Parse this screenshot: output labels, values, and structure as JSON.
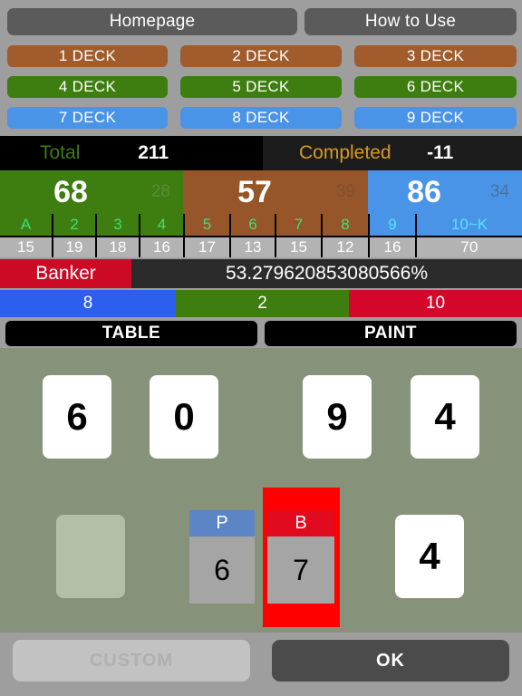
{
  "topnav": {
    "homepage_label": "Homepage",
    "how_to_use_label": "How to Use"
  },
  "decks": [
    {
      "label": "1 DECK",
      "color": "#a05c2c"
    },
    {
      "label": "2 DECK",
      "color": "#a05c2c"
    },
    {
      "label": "3 DECK",
      "color": "#a05c2c"
    },
    {
      "label": "4 DECK",
      "color": "#3e7d10"
    },
    {
      "label": "5 DECK",
      "color": "#3e7d10"
    },
    {
      "label": "6 DECK",
      "color": "#3e7d10"
    },
    {
      "label": "7 DECK",
      "color": "#4a94e8"
    },
    {
      "label": "8 DECK",
      "color": "#4a94e8"
    },
    {
      "label": "9 DECK",
      "color": "#4a94e8"
    }
  ],
  "summary": {
    "total_label": "Total",
    "total_value": "211",
    "completed_label": "Completed",
    "completed_value": "-11"
  },
  "groups": [
    {
      "main": "68",
      "sub": "28",
      "color": "#3e7d10"
    },
    {
      "main": "57",
      "sub": "39",
      "color": "#96562a"
    },
    {
      "main": "86",
      "sub": "34",
      "color": "#4a94e8"
    }
  ],
  "ranks": [
    {
      "rank": "A",
      "count": "15",
      "group": "green"
    },
    {
      "rank": "2",
      "count": "19",
      "group": "green"
    },
    {
      "rank": "3",
      "count": "18",
      "group": "green"
    },
    {
      "rank": "4",
      "count": "16",
      "group": "green"
    },
    {
      "rank": "5",
      "count": "17",
      "group": "brown"
    },
    {
      "rank": "6",
      "count": "13",
      "group": "brown"
    },
    {
      "rank": "7",
      "count": "15",
      "group": "brown"
    },
    {
      "rank": "8",
      "count": "12",
      "group": "brown"
    },
    {
      "rank": "9",
      "count": "16",
      "group": "blue"
    },
    {
      "rank": "10~K",
      "count": "70",
      "group": "blue"
    }
  ],
  "banker": {
    "label": "Banker",
    "percent": "53.279620853080566%",
    "tag_color": "#cc0a26"
  },
  "outcomes": [
    {
      "value": "8",
      "color": "#2c5ef0"
    },
    {
      "value": "2",
      "color": "#3e7d10"
    },
    {
      "value": "10",
      "color": "#d4072b"
    }
  ],
  "modebar": {
    "table_label": "TABLE",
    "paint_label": "PAINT"
  },
  "felt": {
    "background_color": "#869279",
    "row1_cards": [
      {
        "value": "6",
        "empty": false
      },
      {
        "value": "0",
        "empty": false
      },
      {
        "value": "9",
        "empty": false
      },
      {
        "value": "4",
        "empty": false
      }
    ],
    "row2_left_card": {
      "value": "",
      "empty": true
    },
    "row2_right_card": {
      "value": "4",
      "empty": false
    },
    "player_hand": {
      "header_label": "P",
      "value": "6",
      "header_color": "#5b85c4",
      "selected": false
    },
    "banker_hand": {
      "header_label": "B",
      "value": "7",
      "header_color": "#e00b1e",
      "highlight_color": "#ff0000",
      "selected": true
    }
  },
  "bottombar": {
    "custom_label": "CUSTOM",
    "custom_enabled": false,
    "ok_label": "OK",
    "ok_enabled": true
  }
}
